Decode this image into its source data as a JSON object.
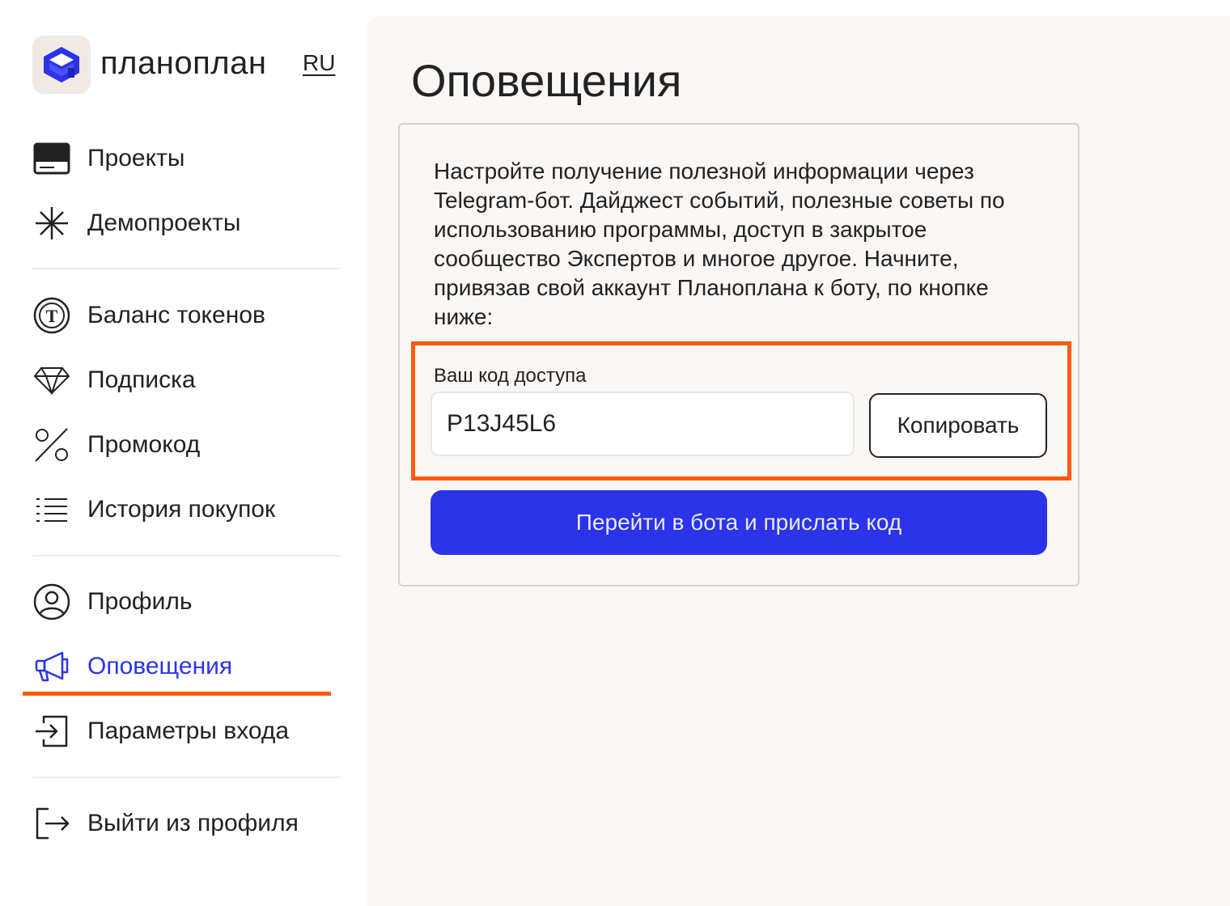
{
  "brand": {
    "name": "планоплан",
    "lang": "RU"
  },
  "sidebar": {
    "items": [
      {
        "label": "Проекты",
        "icon": "projects-icon"
      },
      {
        "label": "Демопроекты",
        "icon": "demo-asterisk-icon"
      },
      {
        "label": "Баланс токенов",
        "icon": "token-icon"
      },
      {
        "label": "Подписка",
        "icon": "diamond-icon"
      },
      {
        "label": "Промокод",
        "icon": "percent-icon"
      },
      {
        "label": "История покупок",
        "icon": "list-icon"
      },
      {
        "label": "Профиль",
        "icon": "user-icon"
      },
      {
        "label": "Оповещения",
        "icon": "megaphone-icon",
        "active": true
      },
      {
        "label": "Параметры входа",
        "icon": "login-icon"
      },
      {
        "label": "Выйти из профиля",
        "icon": "logout-icon"
      }
    ]
  },
  "main": {
    "title": "Оповещения",
    "description": "Настройте получение полезной информации через Telegram-бот. Дайджест событий, полезные советы по использованию программы, доступ в закрытое сообщество Экспертов и многое другое. Начните, привязав свой аккаунт Планоплана к боту, по кнопке ниже:",
    "code_label": "Ваш код доступа",
    "code_value": "P13J45L6",
    "copy_label": "Копировать",
    "bot_button_label": "Перейти в бота и прислать код"
  },
  "colors": {
    "accent": "#2b34e8",
    "highlight": "#ff5a0d",
    "main_bg": "#faf7f5"
  }
}
